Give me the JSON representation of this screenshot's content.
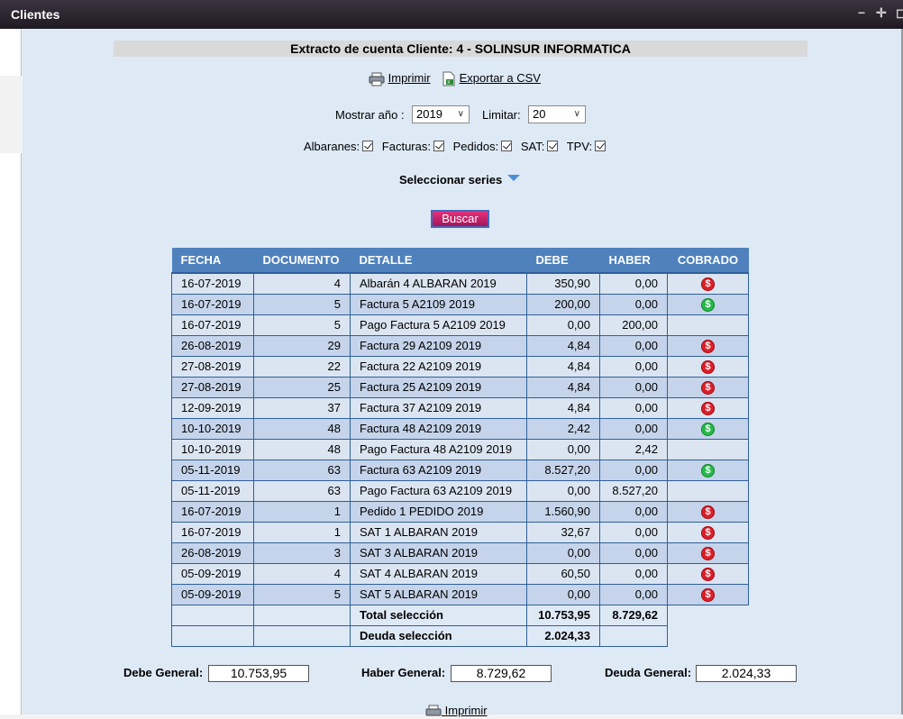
{
  "window": {
    "title": "Clientes",
    "controls": [
      "−",
      "✛",
      "◻"
    ]
  },
  "header": {
    "title": "Extracto de cuenta Cliente: 4 - SOLINSUR INFORMATICA"
  },
  "actions": {
    "print_label": "Imprimir",
    "export_label": "Exportar a CSV"
  },
  "filters": {
    "year_label": "Mostrar año :",
    "year_value": "2019",
    "limit_label": "Limitar:",
    "limit_value": "20",
    "checkboxes": [
      {
        "label": "Albaranes:",
        "checked": true
      },
      {
        "label": "Facturas:",
        "checked": true
      },
      {
        "label": "Pedidos:",
        "checked": true
      },
      {
        "label": "SAT:",
        "checked": true
      },
      {
        "label": "TPV:",
        "checked": true
      }
    ],
    "series_label": "Seleccionar series",
    "search_label": "Buscar"
  },
  "table": {
    "headers": [
      "FECHA",
      "DOCUMENTO",
      "DETALLE",
      "DEBE",
      "HABER",
      "COBRADO"
    ],
    "rows": [
      [
        "16-07-2019",
        "4",
        "Albarán 4 ALBARAN 2019",
        "350,90",
        "0,00",
        "red"
      ],
      [
        "16-07-2019",
        "5",
        "Factura 5 A2109 2019",
        "200,00",
        "0,00",
        "green"
      ],
      [
        "16-07-2019",
        "5",
        "Pago Factura 5 A2109 2019",
        "0,00",
        "200,00",
        ""
      ],
      [
        "26-08-2019",
        "29",
        "Factura 29 A2109 2019",
        "4,84",
        "0,00",
        "red"
      ],
      [
        "27-08-2019",
        "22",
        "Factura 22 A2109 2019",
        "4,84",
        "0,00",
        "red"
      ],
      [
        "27-08-2019",
        "25",
        "Factura 25 A2109 2019",
        "4,84",
        "0,00",
        "red"
      ],
      [
        "12-09-2019",
        "37",
        "Factura 37 A2109 2019",
        "4,84",
        "0,00",
        "red"
      ],
      [
        "10-10-2019",
        "48",
        "Factura 48 A2109 2019",
        "2,42",
        "0,00",
        "green"
      ],
      [
        "10-10-2019",
        "48",
        "Pago Factura 48 A2109 2019",
        "0,00",
        "2,42",
        ""
      ],
      [
        "05-11-2019",
        "63",
        "Factura 63 A2109 2019",
        "8.527,20",
        "0,00",
        "green"
      ],
      [
        "05-11-2019",
        "63",
        "Pago Factura 63 A2109 2019",
        "0,00",
        "8.527,20",
        ""
      ],
      [
        "16-07-2019",
        "1",
        "Pedido 1 PEDIDO 2019",
        "1.560,90",
        "0,00",
        "red"
      ],
      [
        "16-07-2019",
        "1",
        "SAT 1 ALBARAN 2019",
        "32,67",
        "0,00",
        "red"
      ],
      [
        "26-08-2019",
        "3",
        "SAT 3 ALBARAN 2019",
        "0,00",
        "0,00",
        "red"
      ],
      [
        "05-09-2019",
        "4",
        "SAT 4 ALBARAN 2019",
        "60,50",
        "0,00",
        "red"
      ],
      [
        "05-09-2019",
        "5",
        "SAT 5 ALBARAN 2019",
        "0,00",
        "0,00",
        "red"
      ]
    ],
    "total_label": "Total selección",
    "total_debe": "10.753,95",
    "total_haber": "8.729,62",
    "debt_label": "Deuda selección",
    "debt_value": "2.024,33"
  },
  "coin_symbol": "$",
  "general": {
    "debe_label": "Debe General:",
    "debe_value": "10.753,95",
    "haber_label": "Haber General:",
    "haber_value": "8.729,62",
    "deuda_label": "Deuda General:",
    "deuda_value": "2.024,33"
  },
  "colors": {
    "header_blue": "#4f81bd",
    "paid": "#27b84a",
    "unpaid": "#d9202a"
  }
}
